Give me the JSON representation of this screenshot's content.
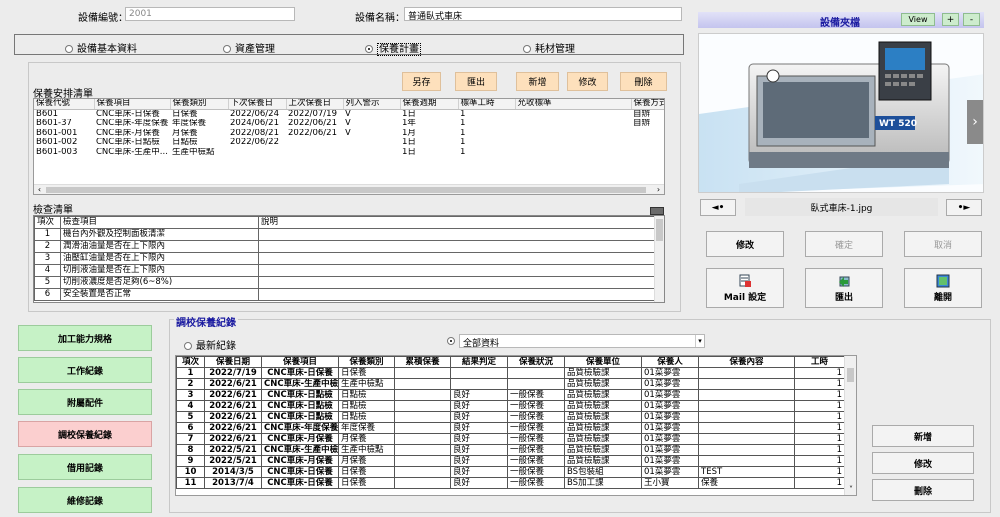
{
  "header": {
    "equip_no_label": "設備編號：",
    "equip_no_value": "2001",
    "equip_name_label": "設備名稱：",
    "equip_name_value": "普通臥式車床"
  },
  "tabs": [
    {
      "label": "設備基本資料",
      "selected": false
    },
    {
      "label": "資產管理",
      "selected": false
    },
    {
      "label": "保養計畫",
      "selected": true
    },
    {
      "label": "耗材管理",
      "selected": false
    }
  ],
  "schedule": {
    "title": "保養安排清單",
    "buttons": {
      "save_as": "另存",
      "export": "匯出",
      "add": "新增",
      "edit": "修改",
      "delete": "刪除"
    },
    "columns": [
      "保養代號",
      "保養項目",
      "保養類別",
      "下次保養日",
      "上次保養日",
      "列入警示",
      "保養週期",
      "標準工時",
      "允收標準",
      "保養方式"
    ],
    "rows": [
      [
        "B601",
        "CNC車床-日保養",
        "日保養",
        "2022/06/24",
        "2022/07/19",
        "V",
        "1日",
        "1",
        "",
        "自辦"
      ],
      [
        "B601-37",
        "CNC車床-年度保養",
        "年度保養",
        "2024/06/21",
        "2022/06/21",
        "V",
        "1年",
        "1",
        "",
        "自辦"
      ],
      [
        "B601-001",
        "CNC車床-月保養",
        "月保養",
        "2022/08/21",
        "2022/06/21",
        "V",
        "1月",
        "1",
        "",
        ""
      ],
      [
        "B601-002",
        "CNC車床-日點檢",
        "日點檢",
        "2022/06/22",
        "",
        "",
        "1日",
        "1",
        "",
        ""
      ],
      [
        "B601-003",
        "CNC車床-生產中...",
        "生產中檢點",
        "",
        "",
        "",
        "1日",
        "1",
        "",
        ""
      ]
    ]
  },
  "checklist": {
    "title": "檢查清單",
    "columns": [
      "項次",
      "檢查項目",
      "說明"
    ],
    "rows": [
      [
        "1",
        "機台內外觀及控制面板清潔",
        ""
      ],
      [
        "2",
        "潤滑油油量是否在上下限內",
        ""
      ],
      [
        "3",
        "油壓缸油量是否在上下限內",
        ""
      ],
      [
        "4",
        "切削液油量是否在上下限內",
        ""
      ],
      [
        "5",
        "切削液濃度是否足夠(6~8%)",
        ""
      ],
      [
        "6",
        "安全裝置是否正常",
        ""
      ]
    ]
  },
  "photo": {
    "title": "設備夾檔",
    "view_label": "View",
    "plus_label": "+",
    "minus_label": "-",
    "filename": "臥式車床-1.jpg",
    "brand_text": "WT 520",
    "prev_icon": "◄•",
    "next_icon": "•►",
    "slide_next": "›"
  },
  "photo_actions": {
    "edit": "修改",
    "confirm": "確定",
    "cancel": "取消",
    "mail": "Mail 設定",
    "export": "匯出",
    "leave": "離開"
  },
  "sidebar": [
    {
      "label": "加工能力規格",
      "active": false
    },
    {
      "label": "工作紀錄",
      "active": false
    },
    {
      "label": "附屬配件",
      "active": false
    },
    {
      "label": "調校保養紀錄",
      "active": true
    },
    {
      "label": "借用記錄",
      "active": false
    },
    {
      "label": "維修記錄",
      "active": false
    }
  ],
  "records": {
    "title": "調校保養紀錄",
    "radio_latest": "最新紀錄",
    "filter_value": "全部資料",
    "columns": [
      "項次",
      "保養日期",
      "保養項目",
      "保養類別",
      "累積保養",
      "結果判定",
      "保養狀況",
      "保養單位",
      "保養人",
      "保養內容",
      "工時"
    ],
    "rows": [
      [
        "1",
        "2022/7/19",
        "CNC車床-日保養",
        "日保養",
        "",
        "",
        "",
        "品質檢驗課",
        "01菜夢雲",
        "",
        "1"
      ],
      [
        "2",
        "2022/6/21",
        "CNC車床-生產中檢點",
        "生產中檢點",
        "",
        "",
        "",
        "品質檢驗課",
        "01菜夢雲",
        "",
        "1"
      ],
      [
        "3",
        "2022/6/21",
        "CNC車床-日點檢",
        "日點檢",
        "",
        "良好",
        "一般保養",
        "品質檢驗課",
        "01菜夢雲",
        "",
        "1"
      ],
      [
        "4",
        "2022/6/21",
        "CNC車床-日點檢",
        "日點檢",
        "",
        "良好",
        "一般保養",
        "品質檢驗課",
        "01菜夢雲",
        "",
        "1"
      ],
      [
        "5",
        "2022/6/21",
        "CNC車床-日點檢",
        "日點檢",
        "",
        "良好",
        "一般保養",
        "品質檢驗課",
        "01菜夢雲",
        "",
        "1"
      ],
      [
        "6",
        "2022/6/21",
        "CNC車床-年度保養",
        "年度保養",
        "",
        "良好",
        "一般保養",
        "品質檢驗課",
        "01菜夢雲",
        "",
        "1"
      ],
      [
        "7",
        "2022/6/21",
        "CNC車床-月保養",
        "月保養",
        "",
        "良好",
        "一般保養",
        "品質檢驗課",
        "01菜夢雲",
        "",
        "1"
      ],
      [
        "8",
        "2022/5/21",
        "CNC車床-生產中檢點",
        "生產中檢點",
        "",
        "良好",
        "一般保養",
        "品質檢驗課",
        "01菜夢雲",
        "",
        "1"
      ],
      [
        "9",
        "2022/5/21",
        "CNC車床-月保養",
        "月保養",
        "",
        "良好",
        "一般保養",
        "品質檢驗課",
        "01菜夢雲",
        "",
        "1"
      ],
      [
        "10",
        "2014/3/5",
        "CNC車床-日保養",
        "日保養",
        "",
        "良好",
        "一般保養",
        "BS包裝組",
        "01菜夢雲",
        "TEST",
        "1"
      ],
      [
        "11",
        "2013/7/4",
        "CNC車床-日保養",
        "日保養",
        "",
        "良好",
        "一般保養",
        "BS加工課",
        "王小寶",
        "保養",
        "1"
      ]
    ]
  },
  "record_actions": {
    "add": "新增",
    "edit": "修改",
    "delete": "刪除"
  }
}
